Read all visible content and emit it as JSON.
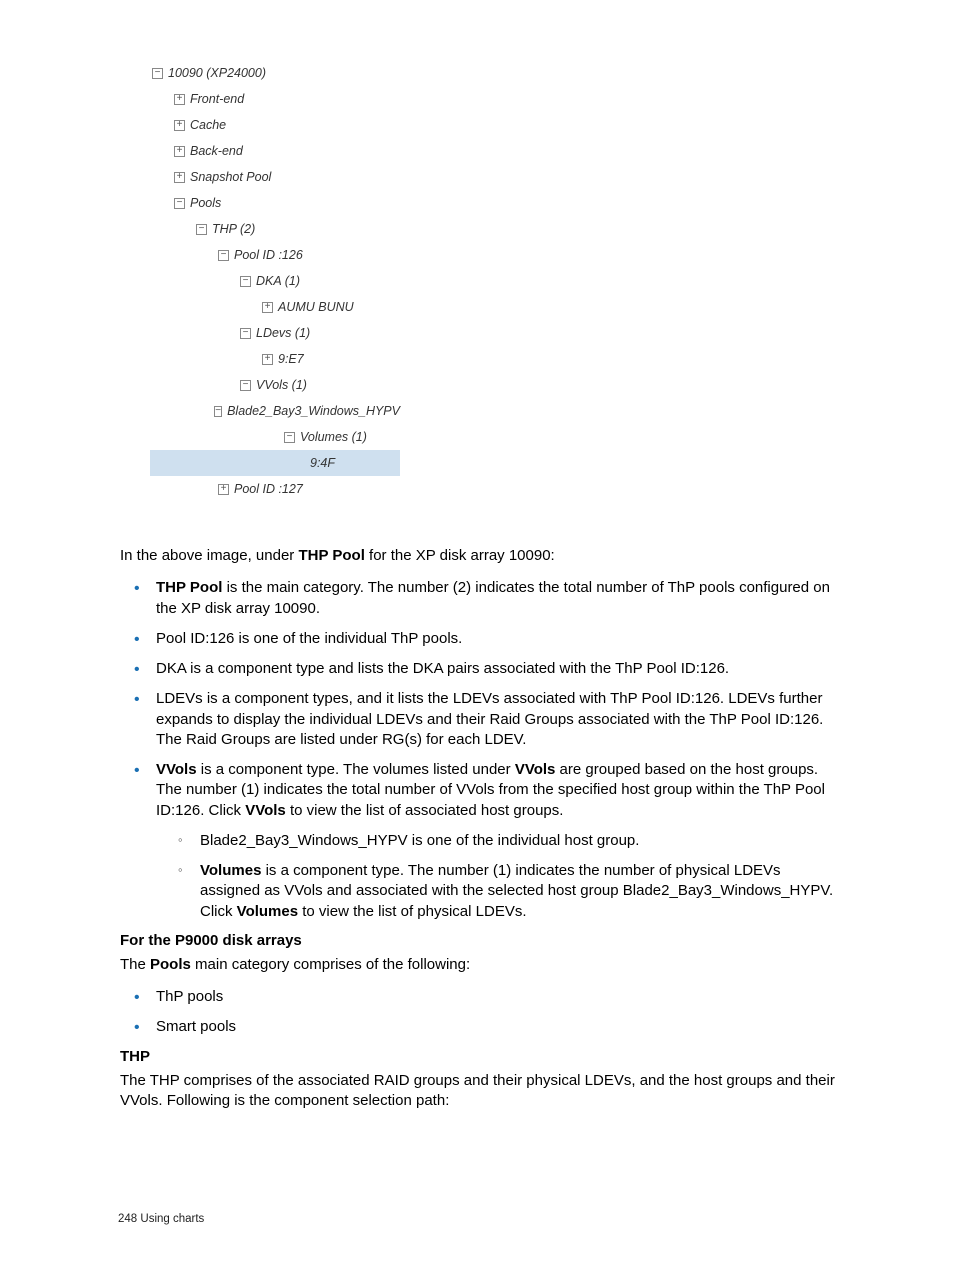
{
  "tree": {
    "root": "10090 (XP24000)",
    "n1": "Front-end",
    "n2": "Cache",
    "n3": "Back-end",
    "n4": "Snapshot Pool",
    "n5": "Pools",
    "n6": "THP (2)",
    "n7": "Pool ID :126",
    "n8": "DKA (1)",
    "n9": "AUMU BUNU",
    "n10": "LDevs (1)",
    "n11": "9:E7",
    "n12": "VVols (1)",
    "n13": "Blade2_Bay3_Windows_HYPV",
    "n14": "Volumes (1)",
    "n15": "9:4F",
    "n16": "Pool ID :127"
  },
  "intro": {
    "p1a": "In the above image, under ",
    "p1b": "THP Pool",
    "p1c": " for the XP disk array 10090:"
  },
  "bul": {
    "b1a": "THP Pool",
    "b1b": " is the main category. The number (2) indicates the total number of ThP pools configured on the XP disk array 10090.",
    "b2": "Pool ID:126 is one of the individual ThP pools.",
    "b3": "DKA is a component type and lists the DKA pairs associated with the ThP Pool ID:126.",
    "b4": "LDEVs is a component types, and it lists the LDEVs associated with ThP Pool ID:126. LDEVs further expands to display the individual LDEVs and their Raid Groups associated with the ThP Pool ID:126. The Raid Groups are listed under RG(s) for each LDEV.",
    "b5a": "VVols",
    "b5b": " is a component type. The volumes listed under ",
    "b5c": "VVols",
    "b5d": " are grouped based on the host groups. The number (1) indicates the total number of VVols from the specified host group within the ThP Pool ID:126. Click ",
    "b5e": "VVols",
    "b5f": " to view the list of associated host groups.",
    "s1": "Blade2_Bay3_Windows_HYPV is one of the individual host group.",
    "s2a": "Volumes",
    "s2b": " is a component type. The number (1) indicates the number of physical LDEVs assigned as VVols and associated with the selected host group Blade2_Bay3_Windows_HYPV. Click ",
    "s2c": "Volumes",
    "s2d": " to view the list of physical LDEVs."
  },
  "sec2": {
    "h": "For the P9000 disk arrays",
    "p1a": "The ",
    "p1b": "Pools",
    "p1c": " main category comprises of the following:",
    "li1": "ThP pools",
    "li2": "Smart pools"
  },
  "sec3": {
    "h": "THP",
    "p1": "The THP comprises of the associated RAID groups and their physical LDEVs, and the host groups and their VVols. Following is the component selection path:"
  },
  "footer": {
    "page": "248",
    "sep": "   ",
    "title": "Using charts"
  },
  "glyph": {
    "plus": "+",
    "minus": "−"
  }
}
